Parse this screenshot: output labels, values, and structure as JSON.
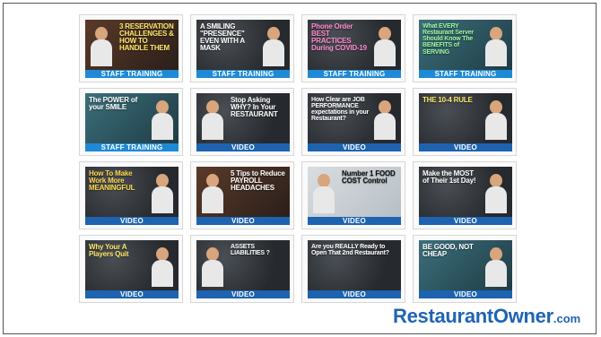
{
  "cards": [
    {
      "title": "3 RESERVATION CHALLENGES & HOW TO HANDLE THEM",
      "label": "STAFF TRAINING",
      "label_type": "training",
      "bg": "warm",
      "color": "#ffe86a"
    },
    {
      "title": "A SMILING \"PRESENCE\" EVEN WITH A MASK",
      "label": "STAFF TRAINING",
      "label_type": "training",
      "bg": "chalk",
      "color": "#ffffff"
    },
    {
      "title": "Phone Order BEST PRACTICES During COVID-19",
      "label": "STAFF TRAINING",
      "label_type": "training",
      "bg": "chalk",
      "color": "#ff8ad0"
    },
    {
      "title": "What EVERY Restaurant Server Should Know The BENEFITS of SERVING",
      "label": "STAFF TRAINING",
      "label_type": "training",
      "bg": "teal",
      "color": "#9ff7a0"
    },
    {
      "title": "The POWER of your SMILE",
      "label": "STAFF TRAINING",
      "label_type": "training",
      "bg": "teal",
      "color": "#ffffff"
    },
    {
      "title": "Stop Asking WHY? In Your RESTAURANT",
      "label": "VIDEO",
      "label_type": "video",
      "bg": "chalk",
      "color": "#ffffff"
    },
    {
      "title": "How Clear are JOB PERFORMANCE expectations in your Restaurant?",
      "label": "VIDEO",
      "label_type": "video",
      "bg": "chalk",
      "color": "#ffffff"
    },
    {
      "title": "THE 10-4 RULE",
      "label": "VIDEO",
      "label_type": "video",
      "bg": "chalk",
      "color": "#ffe86a"
    },
    {
      "title": "How To Make Work More MEANINGFUL",
      "label": "VIDEO",
      "label_type": "video",
      "bg": "chalk",
      "color": "#ffd84a"
    },
    {
      "title": "5 Tips to Reduce PAYROLL HEADACHES",
      "label": "VIDEO",
      "label_type": "video",
      "bg": "warm",
      "color": "#ffffff"
    },
    {
      "title": "Number 1 FOOD COST Control",
      "label": "VIDEO",
      "label_type": "video",
      "bg": "light",
      "color": "#111111"
    },
    {
      "title": "Make the MOST of Their 1st Day!",
      "label": "VIDEO",
      "label_type": "video",
      "bg": "chalk",
      "color": "#ffffff"
    },
    {
      "title": "Why Your A Players Quit",
      "label": "VIDEO",
      "label_type": "video",
      "bg": "chalk",
      "color": "#ffe86a"
    },
    {
      "title": "ASSETS LIABILITIES ?",
      "label": "VIDEO",
      "label_type": "video",
      "bg": "chalk",
      "color": "#ffffff"
    },
    {
      "title": "Are you REALLY Ready to Open That 2nd Restaurant?",
      "label": "VIDEO",
      "label_type": "video",
      "bg": "chalk",
      "color": "#ffffff"
    },
    {
      "title": "BE GOOD, NOT CHEAP",
      "label": "VIDEO",
      "label_type": "video",
      "bg": "teal",
      "color": "#ffffff"
    }
  ],
  "logo": {
    "main": "RestaurantOwner",
    "suffix": ".com",
    "color": "#1f64b4"
  },
  "colors": {
    "training_bar": "#1e8ad6",
    "video_bar": "#1d63b0",
    "frame_border": "#555555"
  }
}
